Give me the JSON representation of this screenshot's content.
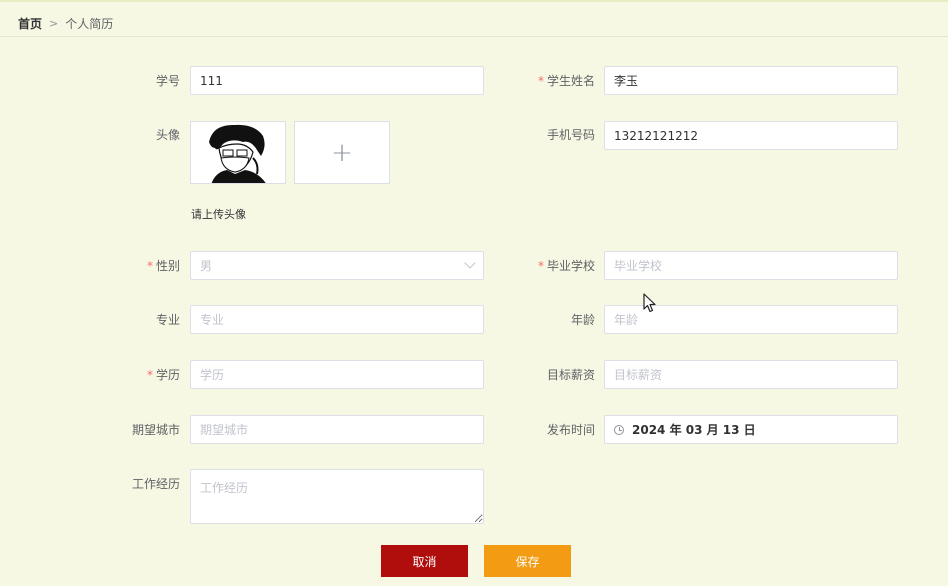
{
  "breadcrumb": {
    "home": "首页",
    "separator": ">",
    "current": "个人简历"
  },
  "form": {
    "student_no": {
      "label": "学号",
      "value": "111"
    },
    "student_name": {
      "label": "学生姓名",
      "value": "李玉",
      "required": "*"
    },
    "avatar": {
      "label": "头像",
      "upload_tip": "请上传头像",
      "add_icon": "+"
    },
    "phone": {
      "label": "手机号码",
      "value": "13212121212"
    },
    "gender": {
      "label": "性别",
      "value": "男",
      "required": "*"
    },
    "school": {
      "label": "毕业学校",
      "placeholder": "毕业学校",
      "required": "*"
    },
    "major": {
      "label": "专业",
      "placeholder": "专业"
    },
    "age": {
      "label": "年龄",
      "placeholder": "年龄"
    },
    "education": {
      "label": "学历",
      "placeholder": "学历",
      "required": "*"
    },
    "salary": {
      "label": "目标薪资",
      "placeholder": "目标薪资"
    },
    "city": {
      "label": "期望城市",
      "placeholder": "期望城市"
    },
    "publish_time": {
      "label": "发布时间",
      "value": "2024 年 03 月 13 日"
    },
    "experience": {
      "label": "工作经历",
      "placeholder": "工作经历"
    }
  },
  "buttons": {
    "cancel": "取消",
    "save": "保存"
  },
  "colors": {
    "background": "#f7f8e4",
    "cancel": "#b00d0d",
    "save": "#f39b12",
    "required": "#f56c6c"
  }
}
